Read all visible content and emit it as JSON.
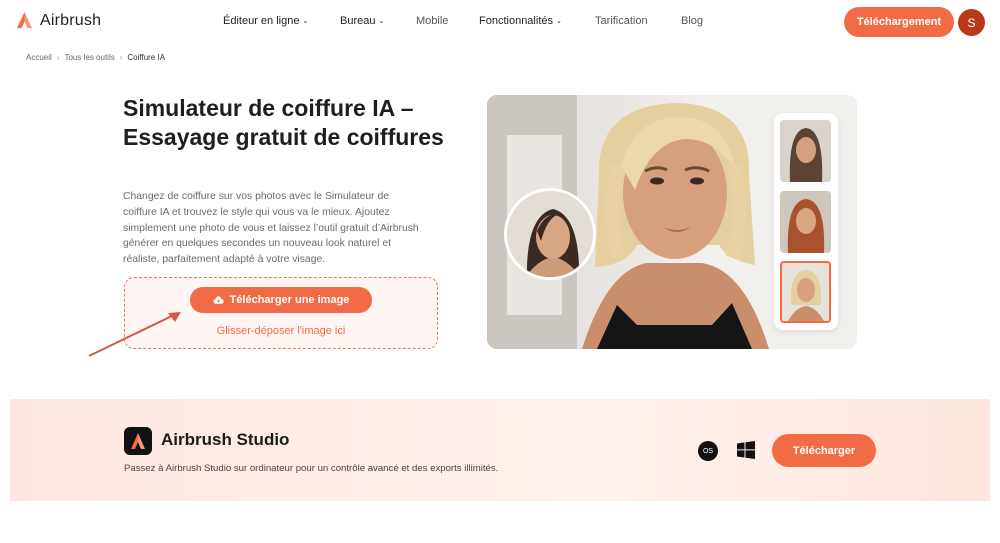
{
  "header": {
    "brand": "Airbrush",
    "nav": [
      {
        "label": "Éditeur en ligne",
        "chevron": true
      },
      {
        "label": "Bureau",
        "chevron": true
      },
      {
        "label": "Mobile",
        "chevron": false
      },
      {
        "label": "Fonctionnalités",
        "chevron": true
      },
      {
        "label": "Tarification",
        "chevron": false
      },
      {
        "label": "Blog",
        "chevron": false
      }
    ],
    "download_label": "Téléchargement",
    "avatar_initial": "S"
  },
  "breadcrumb": [
    "Accueil",
    "Tous les outils",
    "Coiffure IA"
  ],
  "hero": {
    "title": "Simulateur de coiffure IA – Essayage gratuit de coiffures",
    "description": "Changez de coiffure sur vos photos avec le Simulateur de coiffure IA et trouvez le style qui vous va le mieux. Ajoutez simplement une photo de vous et laissez l’outil gratuit d’Airbrush générer en quelques secondes un nouveau look naturel et réaliste, parfaitement adapté à votre visage.",
    "upload_label": "Télécharger une image",
    "drop_label": "Glisser-déposer l'image ici"
  },
  "studio": {
    "title": "Airbrush Studio",
    "description": "Passez à Airbrush Studio sur ordinateur pour un contrôle avancé et des exports illimités.",
    "macos_label": "OS",
    "download_label": "Télécharger"
  },
  "colors": {
    "accent": "#f26b47",
    "avatar": "#b8381a"
  }
}
